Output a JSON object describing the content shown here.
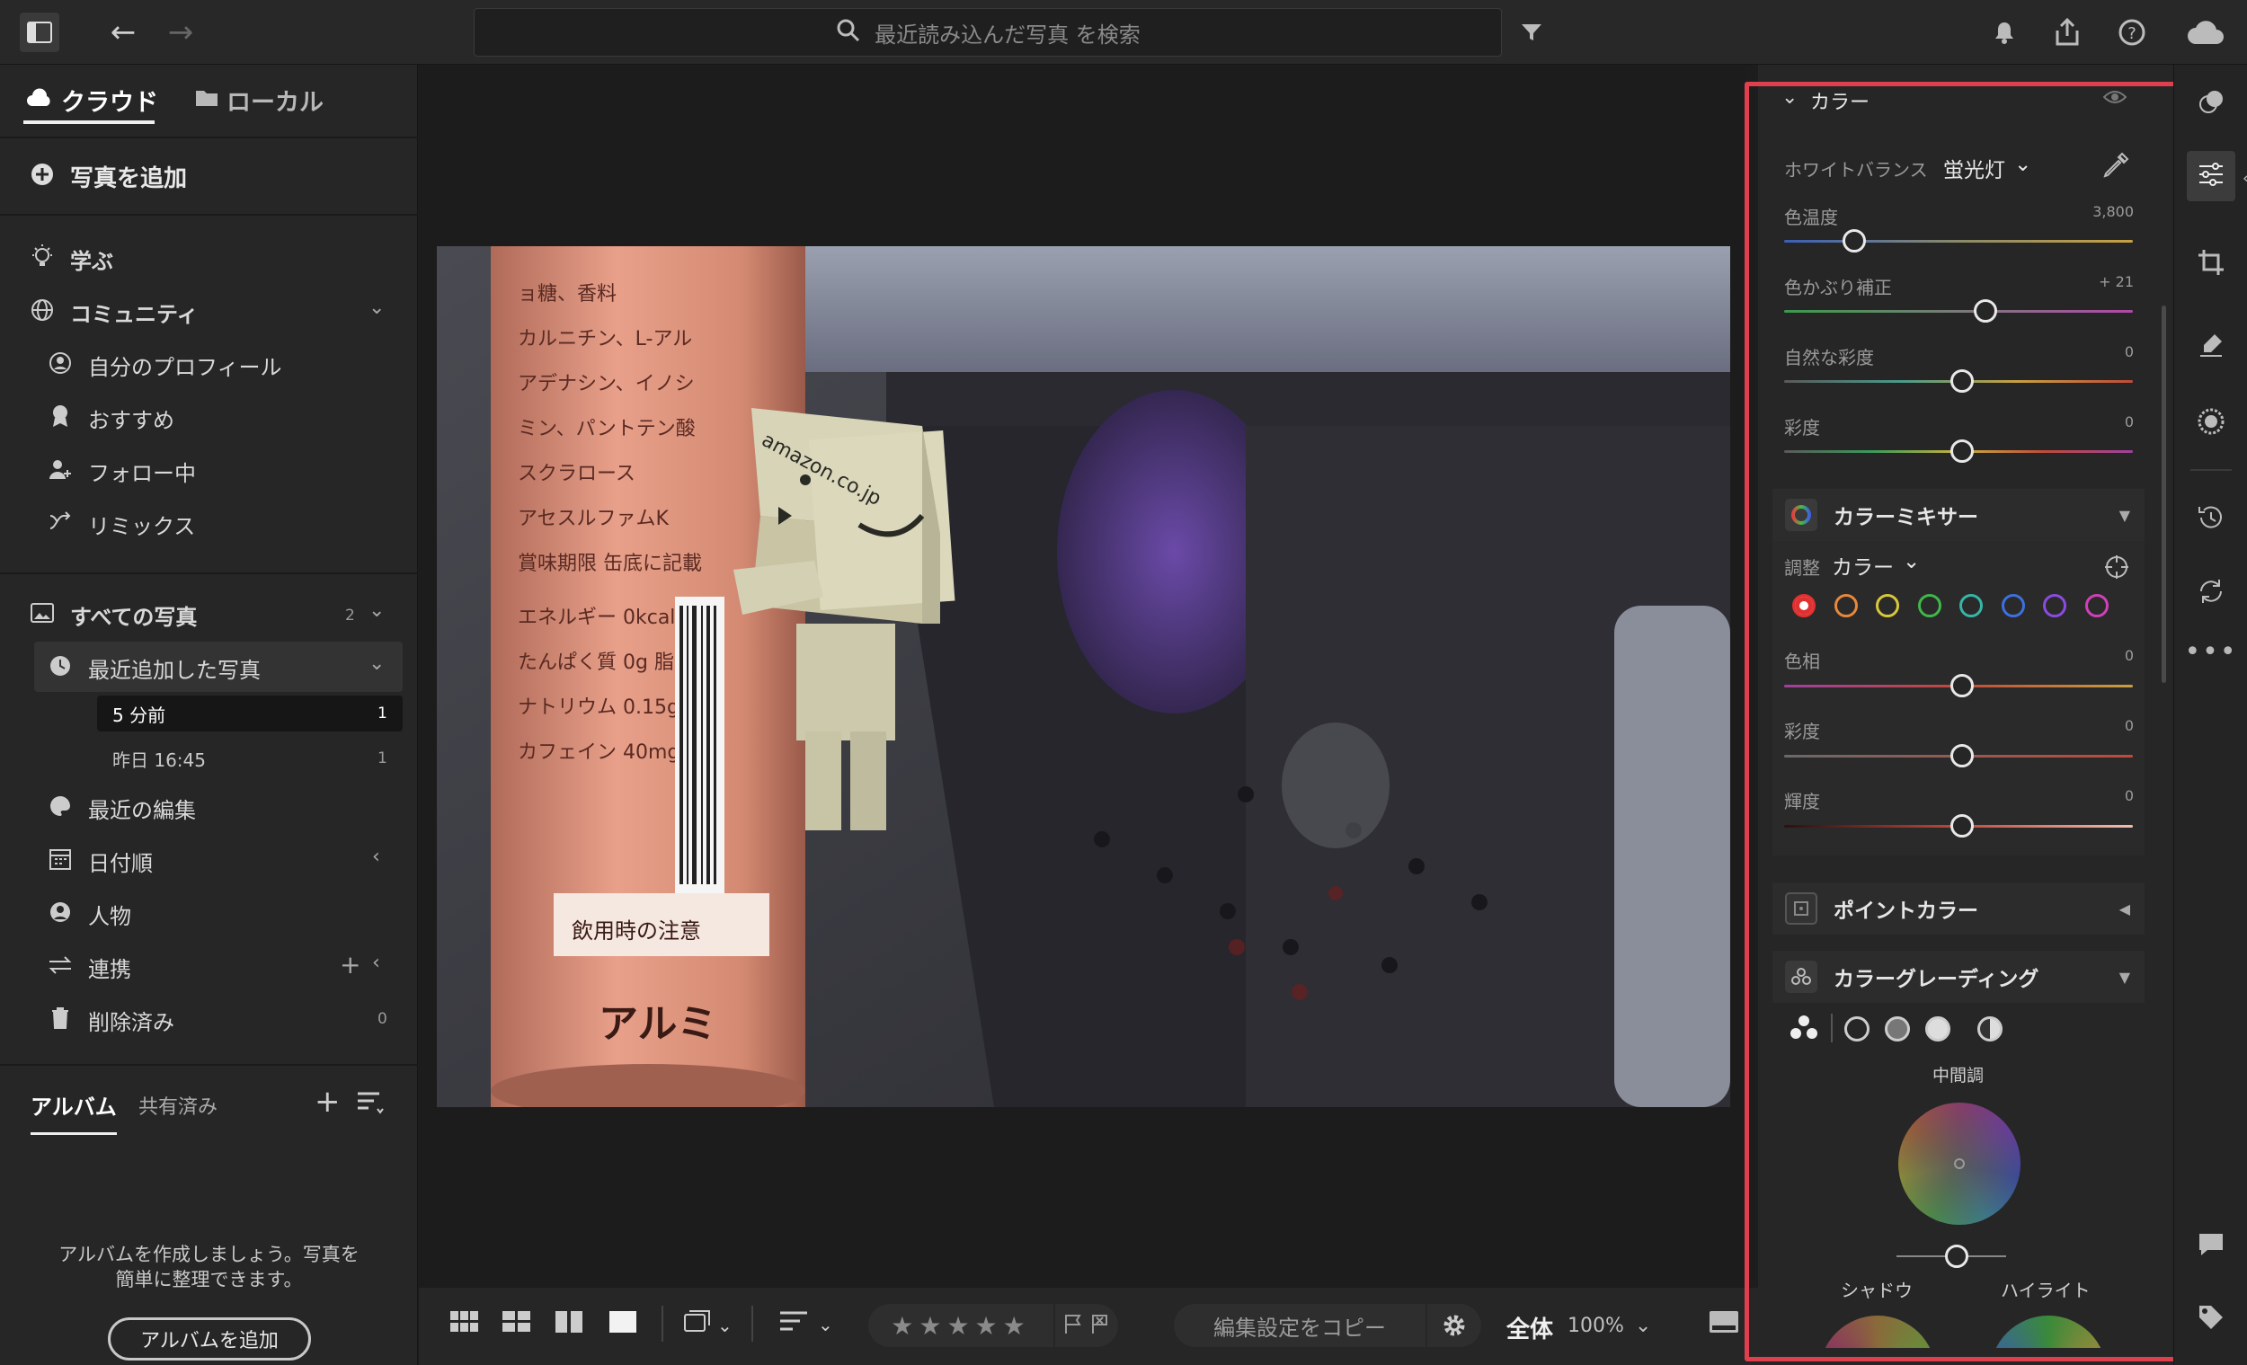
{
  "topbar": {
    "search_placeholder": "最近読み込んだ写真 を検索"
  },
  "source_tabs": {
    "cloud": "クラウド",
    "local": "ローカル"
  },
  "add_photo": "写真を追加",
  "nav": {
    "learn": "学ぶ",
    "community": "コミュニティ",
    "profile": "自分のプロフィール",
    "recommended": "おすすめ",
    "following": "フォロー中",
    "remix": "リミックス",
    "all_photos": "すべての写真",
    "all_photos_count": "2",
    "recently_added": "最近追加した写真",
    "sub_items": [
      {
        "label": "5 分前",
        "count": "1"
      },
      {
        "label": "昨日 16:45",
        "count": "1"
      }
    ],
    "recent_edits": "最近の編集",
    "by_date": "日付順",
    "people": "人物",
    "integrations": "連携",
    "deleted": "削除済み",
    "deleted_count": "0"
  },
  "albums": {
    "tab_albums": "アルバム",
    "tab_shared": "共有済み",
    "empty_text": "アルバムを作成しましょう。写真を簡単に整理できます。",
    "add_button": "アルバムを追加"
  },
  "bottombar": {
    "copy_settings": "編集設定をコピー",
    "zoom_fit": "全体",
    "zoom_pct": "100%",
    "rating": "★★★★★"
  },
  "color_panel": {
    "title": "カラー",
    "white_balance_label": "ホワイトバランス",
    "white_balance_value": "蛍光灯",
    "sliders": [
      {
        "label": "色温度",
        "value": "3,800",
        "pos": 0.13
      },
      {
        "label": "色かぶり補正",
        "value": "+ 21",
        "pos": 0.55
      },
      {
        "label": "自然な彩度",
        "value": "0",
        "pos": 0.5
      },
      {
        "label": "彩度",
        "value": "0",
        "pos": 0.5
      }
    ]
  },
  "color_mixer": {
    "title": "カラーミキサー",
    "adjust_label": "調整",
    "adjust_value": "カラー",
    "swatches": [
      "#e03030",
      "#e8883a",
      "#d8c83a",
      "#3fb84a",
      "#36b6a8",
      "#3d70e0",
      "#8a4ce0",
      "#d040b8"
    ],
    "sliders": [
      {
        "label": "色相",
        "value": "0",
        "pos": 0.5
      },
      {
        "label": "彩度",
        "value": "0",
        "pos": 0.5
      },
      {
        "label": "輝度",
        "value": "0",
        "pos": 0.5
      }
    ]
  },
  "point_color": {
    "title": "ポイントカラー"
  },
  "color_grading": {
    "title": "カラーグレーディング",
    "midtones": "中間調",
    "shadows": "シャドウ",
    "highlights": "ハイライト"
  },
  "photo_text": {
    "brand": "amazon.co.jp",
    "can_label": "アルミ"
  }
}
